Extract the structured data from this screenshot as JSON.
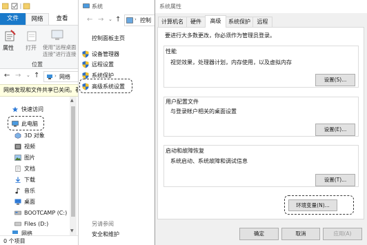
{
  "explorer": {
    "ribbon_tabs": [
      "文件",
      "网络",
      "查看"
    ],
    "ribbon_buttons": {
      "properties": "属性",
      "open": "打开",
      "remote_line1": "使用\"远程桌面",
      "remote_line2": "连接\"进行连接"
    },
    "ribbon_group_label": "位置",
    "nav_path": "网络",
    "info_bar": "网络发现和文件共享已关闭。看",
    "tree": {
      "quick_access": "快速访问",
      "this_pc": "此电脑",
      "objects3d": "3D 对象",
      "videos": "视频",
      "pictures": "图片",
      "documents": "文档",
      "downloads": "下载",
      "music": "音乐",
      "desktop": "桌面",
      "bootcamp": "BOOTCAMP (C:)",
      "files": "Files (D:)",
      "network": "网络"
    },
    "status": "0 个项目"
  },
  "system": {
    "title": "系统",
    "nav_path": "控制",
    "control_panel_home": "控制面板主页",
    "links": {
      "device_manager": "设备管理器",
      "remote": "远程设置",
      "protection": "系统保护",
      "advanced": "高级系统设置"
    },
    "see_also": "另请参阅",
    "security": "安全和维护"
  },
  "props": {
    "title": "系统属性",
    "tabs": [
      "计算机名",
      "硬件",
      "高级",
      "系统保护",
      "远程"
    ],
    "admin_note": "要进行大多数更改，你必须作为管理员登录。",
    "performance": {
      "title": "性能",
      "desc": "视觉效果，处理器计划，内存使用，以及虚拟内存",
      "button": "设置(S)..."
    },
    "profile": {
      "title": "用户配置文件",
      "desc": "与登录帐户相关的桌面设置",
      "button": "设置(E)..."
    },
    "startup": {
      "title": "启动和故障恢复",
      "desc": "系统启动、系统故障和调试信息",
      "button": "设置(T)..."
    },
    "env_button": "环境变量(N)...",
    "ok": "确定",
    "cancel": "取消",
    "apply": "应用(A)"
  },
  "colors": {
    "file_tab": "#1979ca",
    "accent": "#0078d7",
    "link": "#1a1a1a",
    "divider": "#dcdcdc"
  }
}
